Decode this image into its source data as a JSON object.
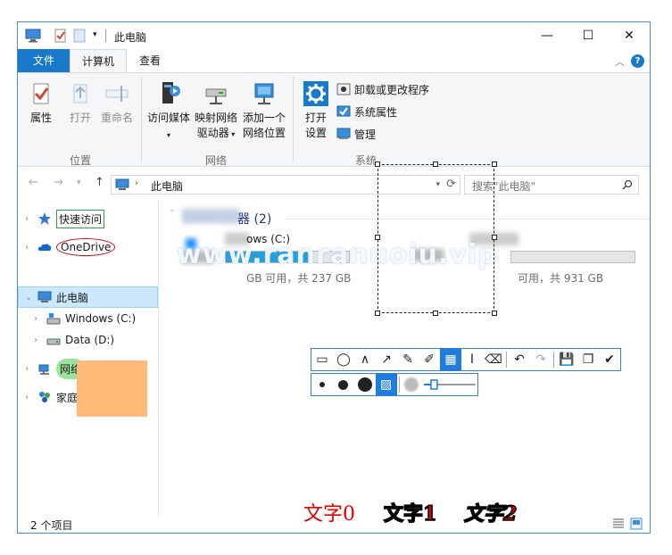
{
  "window": {
    "title": "此电脑",
    "controls": {
      "minimize": "—",
      "maximize": "☐",
      "close": "✕"
    }
  },
  "tabs": {
    "file": "文件",
    "computer": "计算机",
    "view": "查看",
    "help": "?"
  },
  "ribbon": {
    "location": {
      "label": "位置",
      "properties": "属性",
      "open": "打开",
      "rename": "重命名"
    },
    "network": {
      "label": "网络",
      "media": "访问媒体",
      "map_drive_1": "映射网络",
      "map_drive_2": "驱动器",
      "add_location_1": "添加一个",
      "add_location_2": "网络位置"
    },
    "system": {
      "label": "系统",
      "open_settings_1": "打开",
      "open_settings_2": "设置",
      "uninstall": "卸载或更改程序",
      "system_props": "系统属性",
      "manage": "管理"
    }
  },
  "address": {
    "path": "此电脑",
    "search_placeholder": "搜索\"此电脑\""
  },
  "nav": {
    "quick_access": "快速访问",
    "onedrive": "OneDrive",
    "this_pc": "此电脑",
    "windows_c": "Windows (C:)",
    "data_d": "Data (D:)",
    "network": "网络",
    "homegroup": "家庭组"
  },
  "content": {
    "group_title": "器 (2)",
    "drive_c_name": "ows (C:)",
    "drive_c_free": "GB 可用，共 237 GB",
    "drive_d_free": "可用，共 931 GB"
  },
  "status": {
    "items": "2 个项目"
  },
  "overlay": {
    "watermark": "www.ranranuoiu.vip",
    "text0": "文字0",
    "text1": "文字1",
    "text2": "文字2"
  },
  "colors": {
    "accent": "#1979ca",
    "selection": "#cce8ff",
    "annotation_red": "#e00000"
  }
}
